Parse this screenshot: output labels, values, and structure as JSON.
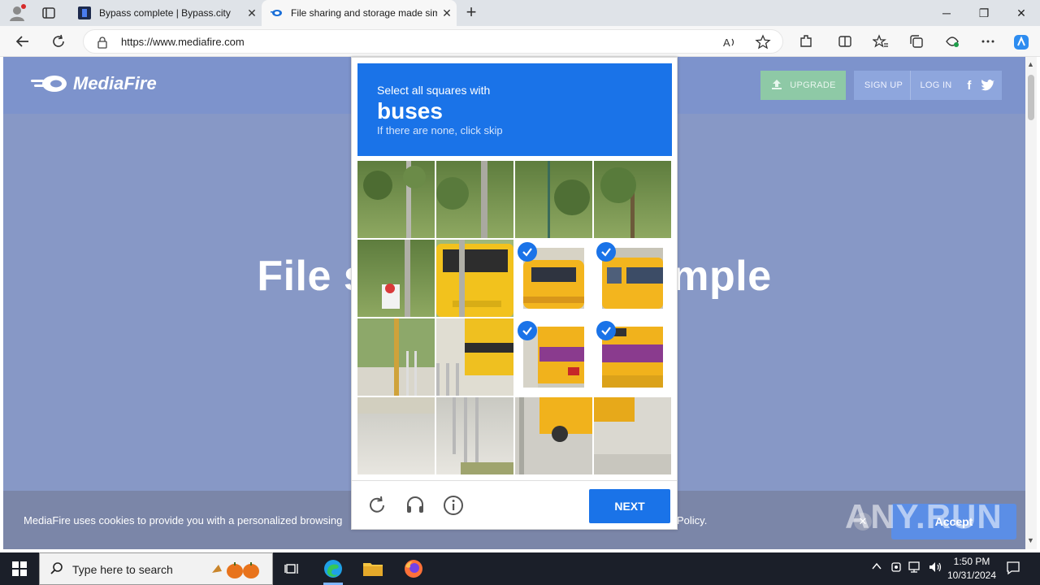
{
  "browser": {
    "tabs": [
      {
        "title": "Bypass complete | Bypass.city",
        "active": false
      },
      {
        "title": "File sharing and storage made simple",
        "active": true
      }
    ],
    "address_bar": {
      "url": "https://www.mediafire.com"
    },
    "accent_color": "#1a73e8"
  },
  "page": {
    "brand": "MediaFire",
    "header_buttons": {
      "upgrade": "UPGRADE",
      "signup": "SIGN UP",
      "login": "LOG IN"
    },
    "hero_text": "File storage made simple",
    "cookie_banner": {
      "message": "MediaFire uses cookies to provide you with a personalized browsing",
      "policy_tail": "Policy.",
      "accept_label": "Accept"
    }
  },
  "captcha": {
    "instruction": "Select all squares with",
    "target": "buses",
    "hint": "If there are none, click skip",
    "selected_cells": [
      6,
      7,
      10,
      11
    ],
    "next_label": "NEXT",
    "icons": [
      "refresh-icon",
      "audio-icon",
      "info-icon"
    ]
  },
  "watermark": "ANY.RUN",
  "taskbar": {
    "search_placeholder": "Type here to search",
    "time": "1:50 PM",
    "date": "10/31/2024"
  }
}
